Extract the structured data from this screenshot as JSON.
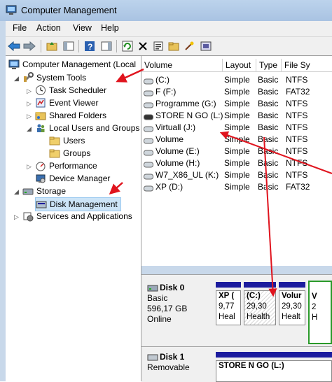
{
  "window": {
    "title": "Computer Management"
  },
  "menu": [
    "File",
    "Action",
    "View",
    "Help"
  ],
  "tree": {
    "root": "Computer Management (Local",
    "system_tools": "System Tools",
    "task_scheduler": "Task Scheduler",
    "event_viewer": "Event Viewer",
    "shared_folders": "Shared Folders",
    "local_users": "Local Users and Groups",
    "users": "Users",
    "groups": "Groups",
    "performance": "Performance",
    "device_manager": "Device Manager",
    "storage": "Storage",
    "disk_management": "Disk Management",
    "services": "Services and Applications"
  },
  "columns": [
    "Volume",
    "Layout",
    "Type",
    "File Sy"
  ],
  "volumes": [
    {
      "volume": "(C:)",
      "layout": "Simple",
      "type": "Basic",
      "fs": "NTFS"
    },
    {
      "volume": "F (F:)",
      "layout": "Simple",
      "type": "Basic",
      "fs": "FAT32"
    },
    {
      "volume": "Programme (G:)",
      "layout": "Simple",
      "type": "Basic",
      "fs": "NTFS"
    },
    {
      "volume": "STORE N GO (L:)",
      "layout": "Simple",
      "type": "Basic",
      "fs": "NTFS"
    },
    {
      "volume": "Virtuall (J:)",
      "layout": "Simple",
      "type": "Basic",
      "fs": "NTFS"
    },
    {
      "volume": "Volume",
      "layout": "Simple",
      "type": "Basic",
      "fs": "NTFS"
    },
    {
      "volume": "Volume (E:)",
      "layout": "Simple",
      "type": "Basic",
      "fs": "NTFS"
    },
    {
      "volume": "Volume (H:)",
      "layout": "Simple",
      "type": "Basic",
      "fs": "NTFS"
    },
    {
      "volume": "W7_X86_UL (K:)",
      "layout": "Simple",
      "type": "Basic",
      "fs": "NTFS"
    },
    {
      "volume": "XP (D:)",
      "layout": "Simple",
      "type": "Basic",
      "fs": "FAT32"
    }
  ],
  "disk0": {
    "name": "Disk 0",
    "type": "Basic",
    "size": "596,17 GB",
    "status": "Online",
    "partitions": [
      {
        "name": "XP (",
        "size": "9,77",
        "status": "Heal"
      },
      {
        "name": "(C:)",
        "size": "29,30",
        "status": "Health"
      },
      {
        "name": "Volur",
        "size": "29,30",
        "status": "Healt"
      },
      {
        "name": "V",
        "size": "2",
        "status": "H"
      }
    ]
  },
  "disk1": {
    "name": "Disk 1",
    "type": "Removable",
    "partition": {
      "name": "STORE N GO  (L:)"
    }
  },
  "colors": {
    "accent": "#1c1c9e",
    "arrow": "#e0141e",
    "select": "#cce4f7"
  }
}
